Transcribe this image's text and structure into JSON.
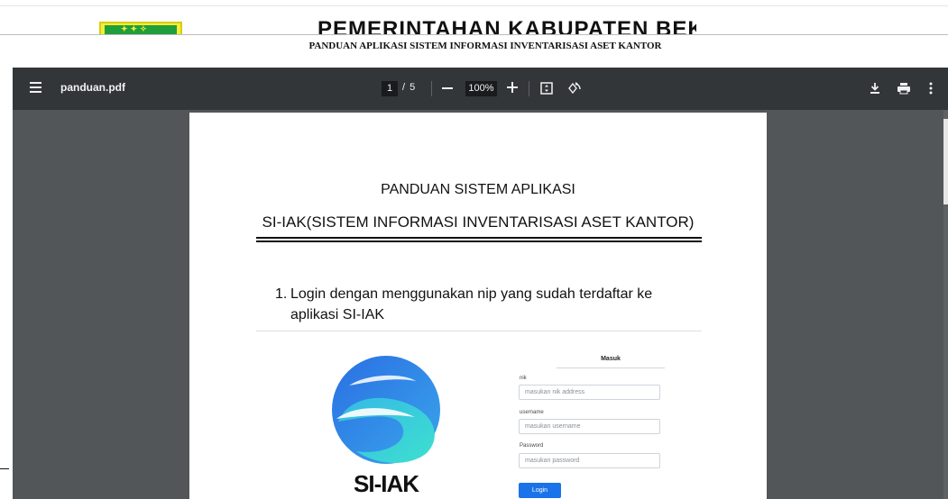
{
  "site": {
    "title": "PEMERINTAHAN KABUPATEN BEKASI",
    "subtitle": "PANDUAN APLIKASI SISTEM INFORMASI INVENTARISASI ASET KANTOR"
  },
  "viewer": {
    "file_name": "panduan.pdf",
    "current_page": "1",
    "page_total": "/ 5",
    "zoom": "100%",
    "icons": {
      "menu": "menu-icon",
      "zoom_out": "minus-icon",
      "zoom_in": "plus-icon",
      "fit": "fit-page-icon",
      "rotate": "rotate-icon",
      "download": "download-icon",
      "print": "print-icon",
      "more": "more-vert-icon"
    },
    "colors": {
      "toolbar_bg": "#323639",
      "viewer_bg": "#525659",
      "button_blue": "#1a73e8",
      "logo_blue": "#2a7be4",
      "logo_cyan": "#3dd6d0"
    }
  },
  "page": {
    "title_line1": "PANDUAN SISTEM APLIKASI",
    "title_line2": "SI-IAK(SISTEM INFORMASI INVENTARISASI ASET KANTOR)",
    "step_number": "1.",
    "step_text": "Login dengan menggunakan nip yang sudah terdaftar ke aplikasi SI-IAK",
    "logo_text": "SI-IAK",
    "form": {
      "heading": "Masuk",
      "nik_label": "nik",
      "nik_placeholder": "masukan nik address",
      "username_label": "username",
      "username_placeholder": "masukan username",
      "password_label": "Password",
      "password_placeholder": "masukan password",
      "button_label": "Login"
    }
  }
}
